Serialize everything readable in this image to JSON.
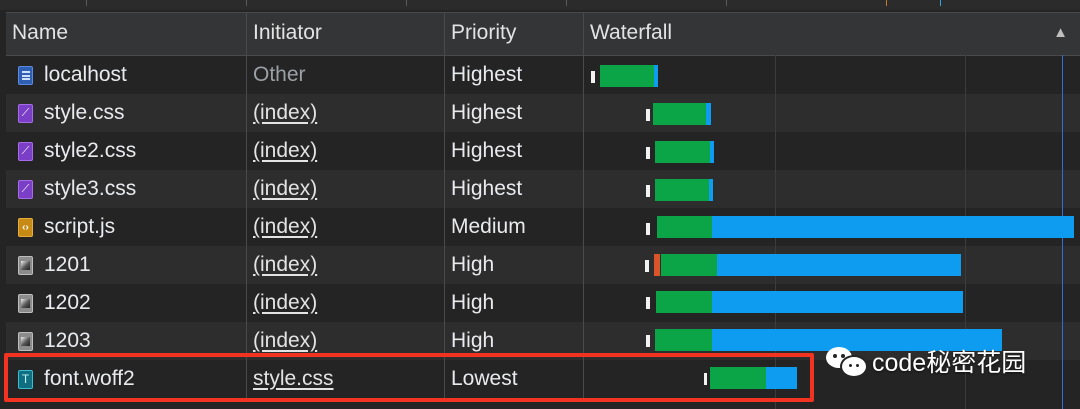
{
  "header": {
    "name": "Name",
    "initiator": "Initiator",
    "priority": "Priority",
    "waterfall": "Waterfall",
    "sort_glyph": "▲"
  },
  "rows": [
    {
      "name": "localhost",
      "icon": "document-icon",
      "initiator": "Other",
      "priority": "Highest"
    },
    {
      "name": "style.css",
      "icon": "stylesheet-icon",
      "initiator": "(index)",
      "priority": "Highest"
    },
    {
      "name": "style2.css",
      "icon": "stylesheet-icon",
      "initiator": "(index)",
      "priority": "Highest"
    },
    {
      "name": "style3.css",
      "icon": "stylesheet-icon",
      "initiator": "(index)",
      "priority": "Highest"
    },
    {
      "name": "script.js",
      "icon": "script-icon",
      "initiator": "(index)",
      "priority": "Medium"
    },
    {
      "name": "1201",
      "icon": "image-icon",
      "initiator": "(index)",
      "priority": "High"
    },
    {
      "name": "1202",
      "icon": "image-icon",
      "initiator": "(index)",
      "priority": "High"
    },
    {
      "name": "1203",
      "icon": "image-icon",
      "initiator": "(index)",
      "priority": "High"
    },
    {
      "name": "font.woff2",
      "icon": "font-icon",
      "initiator": "style.css",
      "priority": "Lowest"
    }
  ],
  "icon_glyphs": {
    "stylesheet-icon": "⟋",
    "script-icon": "‹›",
    "font-icon": "T"
  },
  "watermark": {
    "text": "code秘密花园",
    "icon": "wechat-logo-icon"
  },
  "colors": {
    "waiting": "#0ba548",
    "download": "#0d9cf0",
    "highlight": "#f23322"
  }
}
